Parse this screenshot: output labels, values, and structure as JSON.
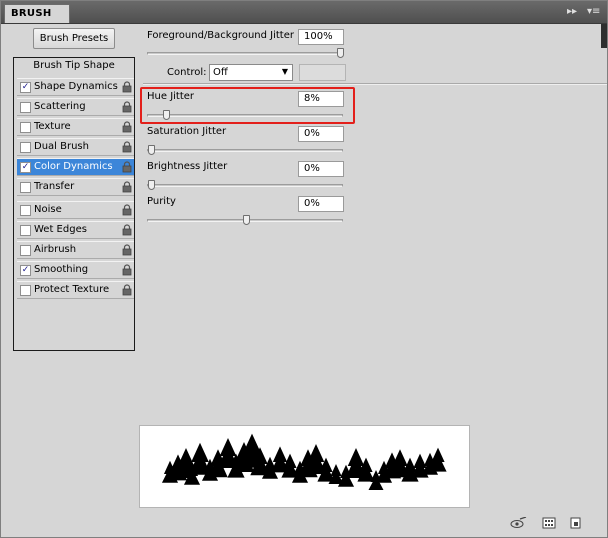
{
  "panel": {
    "tab_label": "BRUSH",
    "collapse_glyph": "▸▸",
    "menu_glyph": "▾≡"
  },
  "brush_presets_button": "Brush Presets",
  "brush_tip_shape": "Brush Tip Shape",
  "options": [
    {
      "label": "Shape Dynamics",
      "checked": true,
      "selected": false
    },
    {
      "label": "Scattering",
      "checked": false,
      "selected": false
    },
    {
      "label": "Texture",
      "checked": false,
      "selected": false
    },
    {
      "label": "Dual Brush",
      "checked": false,
      "selected": false
    },
    {
      "label": "Color Dynamics",
      "checked": true,
      "selected": true
    },
    {
      "label": "Transfer",
      "checked": false,
      "selected": false
    },
    {
      "label": "Noise",
      "checked": false,
      "selected": false
    },
    {
      "label": "Wet Edges",
      "checked": false,
      "selected": false
    },
    {
      "label": "Airbrush",
      "checked": false,
      "selected": false
    },
    {
      "label": "Smoothing",
      "checked": true,
      "selected": false
    },
    {
      "label": "Protect Texture",
      "checked": false,
      "selected": false
    }
  ],
  "settings": {
    "fg_bg_jitter": {
      "label": "Foreground/Background Jitter",
      "value": "100%",
      "level": 1.0
    },
    "control": {
      "label": "Control:",
      "value": "Off"
    },
    "hue_jitter": {
      "label": "Hue Jitter",
      "value": "8%",
      "level": 0.08
    },
    "saturation_jitter": {
      "label": "Saturation Jitter",
      "value": "0%",
      "level": 0.0
    },
    "brightness_jitter": {
      "label": "Brightness Jitter",
      "value": "0%",
      "level": 0.0
    },
    "purity": {
      "label": "Purity",
      "value": "0%",
      "level": 0.5
    }
  },
  "colors": {
    "selected_row": "#3c86d9",
    "highlight_border": "#e3201b",
    "panel_bg": "#d6d6d6"
  },
  "icons": [
    "lock-icon",
    "checkmark-icon",
    "dropdown-arrow-icon",
    "eye-brush-icon",
    "grid-icon",
    "new-preset-icon"
  ]
}
